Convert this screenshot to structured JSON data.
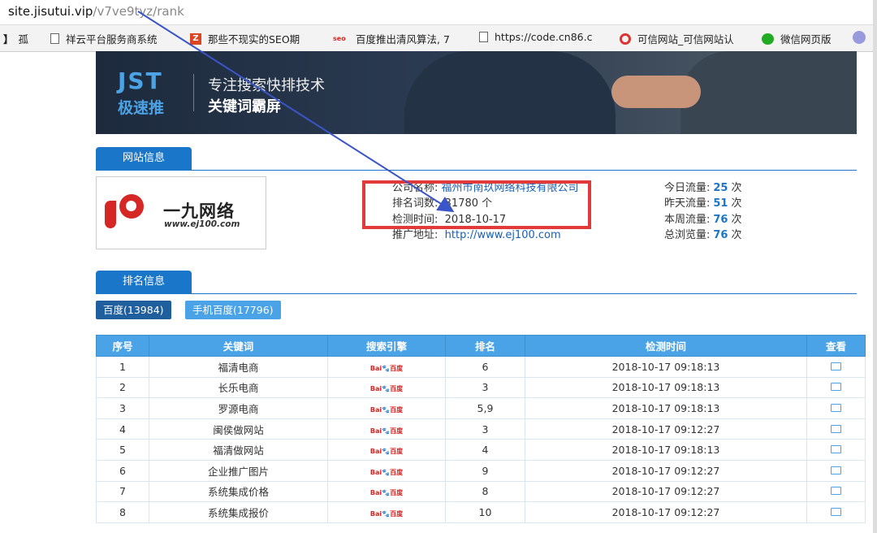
{
  "address_bar": {
    "domain": "site.jisutui.vip",
    "path": "/v7ve9tyz/rank"
  },
  "bookmarks": [
    {
      "icon": "bracket-icon",
      "label": "孤"
    },
    {
      "icon": "page-icon",
      "label": "祥云平台服务商系统"
    },
    {
      "icon": "z-icon",
      "label": "那些不现实的SEO期"
    },
    {
      "icon": "seo-icon",
      "label": "百度推出清风算法, 7"
    },
    {
      "icon": "page-icon",
      "label": "https://code.cn86.c"
    },
    {
      "icon": "trust-icon",
      "label": "可信网站_可信网站认"
    },
    {
      "icon": "wechat-icon",
      "label": "微信网页版"
    }
  ],
  "banner": {
    "brand_en": "JST",
    "brand_cn": "极速推",
    "tagline": "专注搜索快排技术",
    "slogan": "关键词霸屏"
  },
  "site_info": {
    "tab": "网站信息",
    "logo_name": "一九网络",
    "logo_url": "www.ej100.com",
    "company_label": "公司名称:",
    "company_value": "福州市南玖网络科技有限公司",
    "keywords_label": "排名词数:",
    "keywords_value": "31780 个",
    "date_label": "检测时间:",
    "date_value": "2018-10-17",
    "url_label": "推广地址:",
    "url_value": "http://www.ej100.com",
    "stats": [
      {
        "label": "今日流量:",
        "value": "25",
        "unit": "次"
      },
      {
        "label": "昨天流量:",
        "value": "51",
        "unit": "次"
      },
      {
        "label": "本周流量:",
        "value": "76",
        "unit": "次"
      },
      {
        "label": "总浏览量:",
        "value": "76",
        "unit": "次"
      }
    ]
  },
  "rank_info": {
    "tab": "排名信息",
    "engine_tabs": [
      {
        "label": "百度(13984)",
        "color": "#1f5f9e"
      },
      {
        "label": "手机百度(17796)",
        "color": "#4aa3e6"
      }
    ],
    "columns": [
      "序号",
      "关键词",
      "搜索引擎",
      "排名",
      "检测时间",
      "查看"
    ],
    "baidu_logo": {
      "left": "Bai",
      "right": "百度"
    },
    "rows": [
      {
        "no": "1",
        "keyword": "福清电商",
        "rank": "6",
        "time": "2018-10-17 09:18:13"
      },
      {
        "no": "2",
        "keyword": "长乐电商",
        "rank": "3",
        "time": "2018-10-17 09:18:13"
      },
      {
        "no": "3",
        "keyword": "罗源电商",
        "rank": "5,9",
        "time": "2018-10-17 09:18:13"
      },
      {
        "no": "4",
        "keyword": "闽侯做网站",
        "rank": "3",
        "time": "2018-10-17 09:12:27"
      },
      {
        "no": "5",
        "keyword": "福清做网站",
        "rank": "4",
        "time": "2018-10-17 09:18:13"
      },
      {
        "no": "6",
        "keyword": "企业推广图片",
        "rank": "9",
        "time": "2018-10-17 09:12:27"
      },
      {
        "no": "7",
        "keyword": "系统集成价格",
        "rank": "8",
        "time": "2018-10-17 09:12:27"
      },
      {
        "no": "8",
        "keyword": "系统集成报价",
        "rank": "10",
        "time": "2018-10-17 09:12:27"
      }
    ]
  },
  "colors": {
    "accent": "#1a76c8",
    "header": "#4aa3e6",
    "highlight": "#e23a3a"
  }
}
